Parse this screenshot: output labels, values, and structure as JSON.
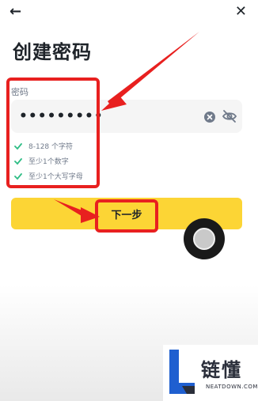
{
  "header": {
    "back_icon": "←",
    "close_icon": "✕"
  },
  "page": {
    "title": "创建密码"
  },
  "password": {
    "label": "密码",
    "value": "•••••••••"
  },
  "rules": [
    {
      "text": "8-128 个字符"
    },
    {
      "text": "至少1个数字"
    },
    {
      "text": "至少1个大写字母"
    }
  ],
  "button": {
    "next_label": "下一步"
  },
  "colors": {
    "accent": "#fcd535",
    "highlight": "#e8201f",
    "check": "#2ebd85"
  },
  "watermark": {
    "text": "链懂",
    "sub": "NEATDOWN.COM"
  }
}
